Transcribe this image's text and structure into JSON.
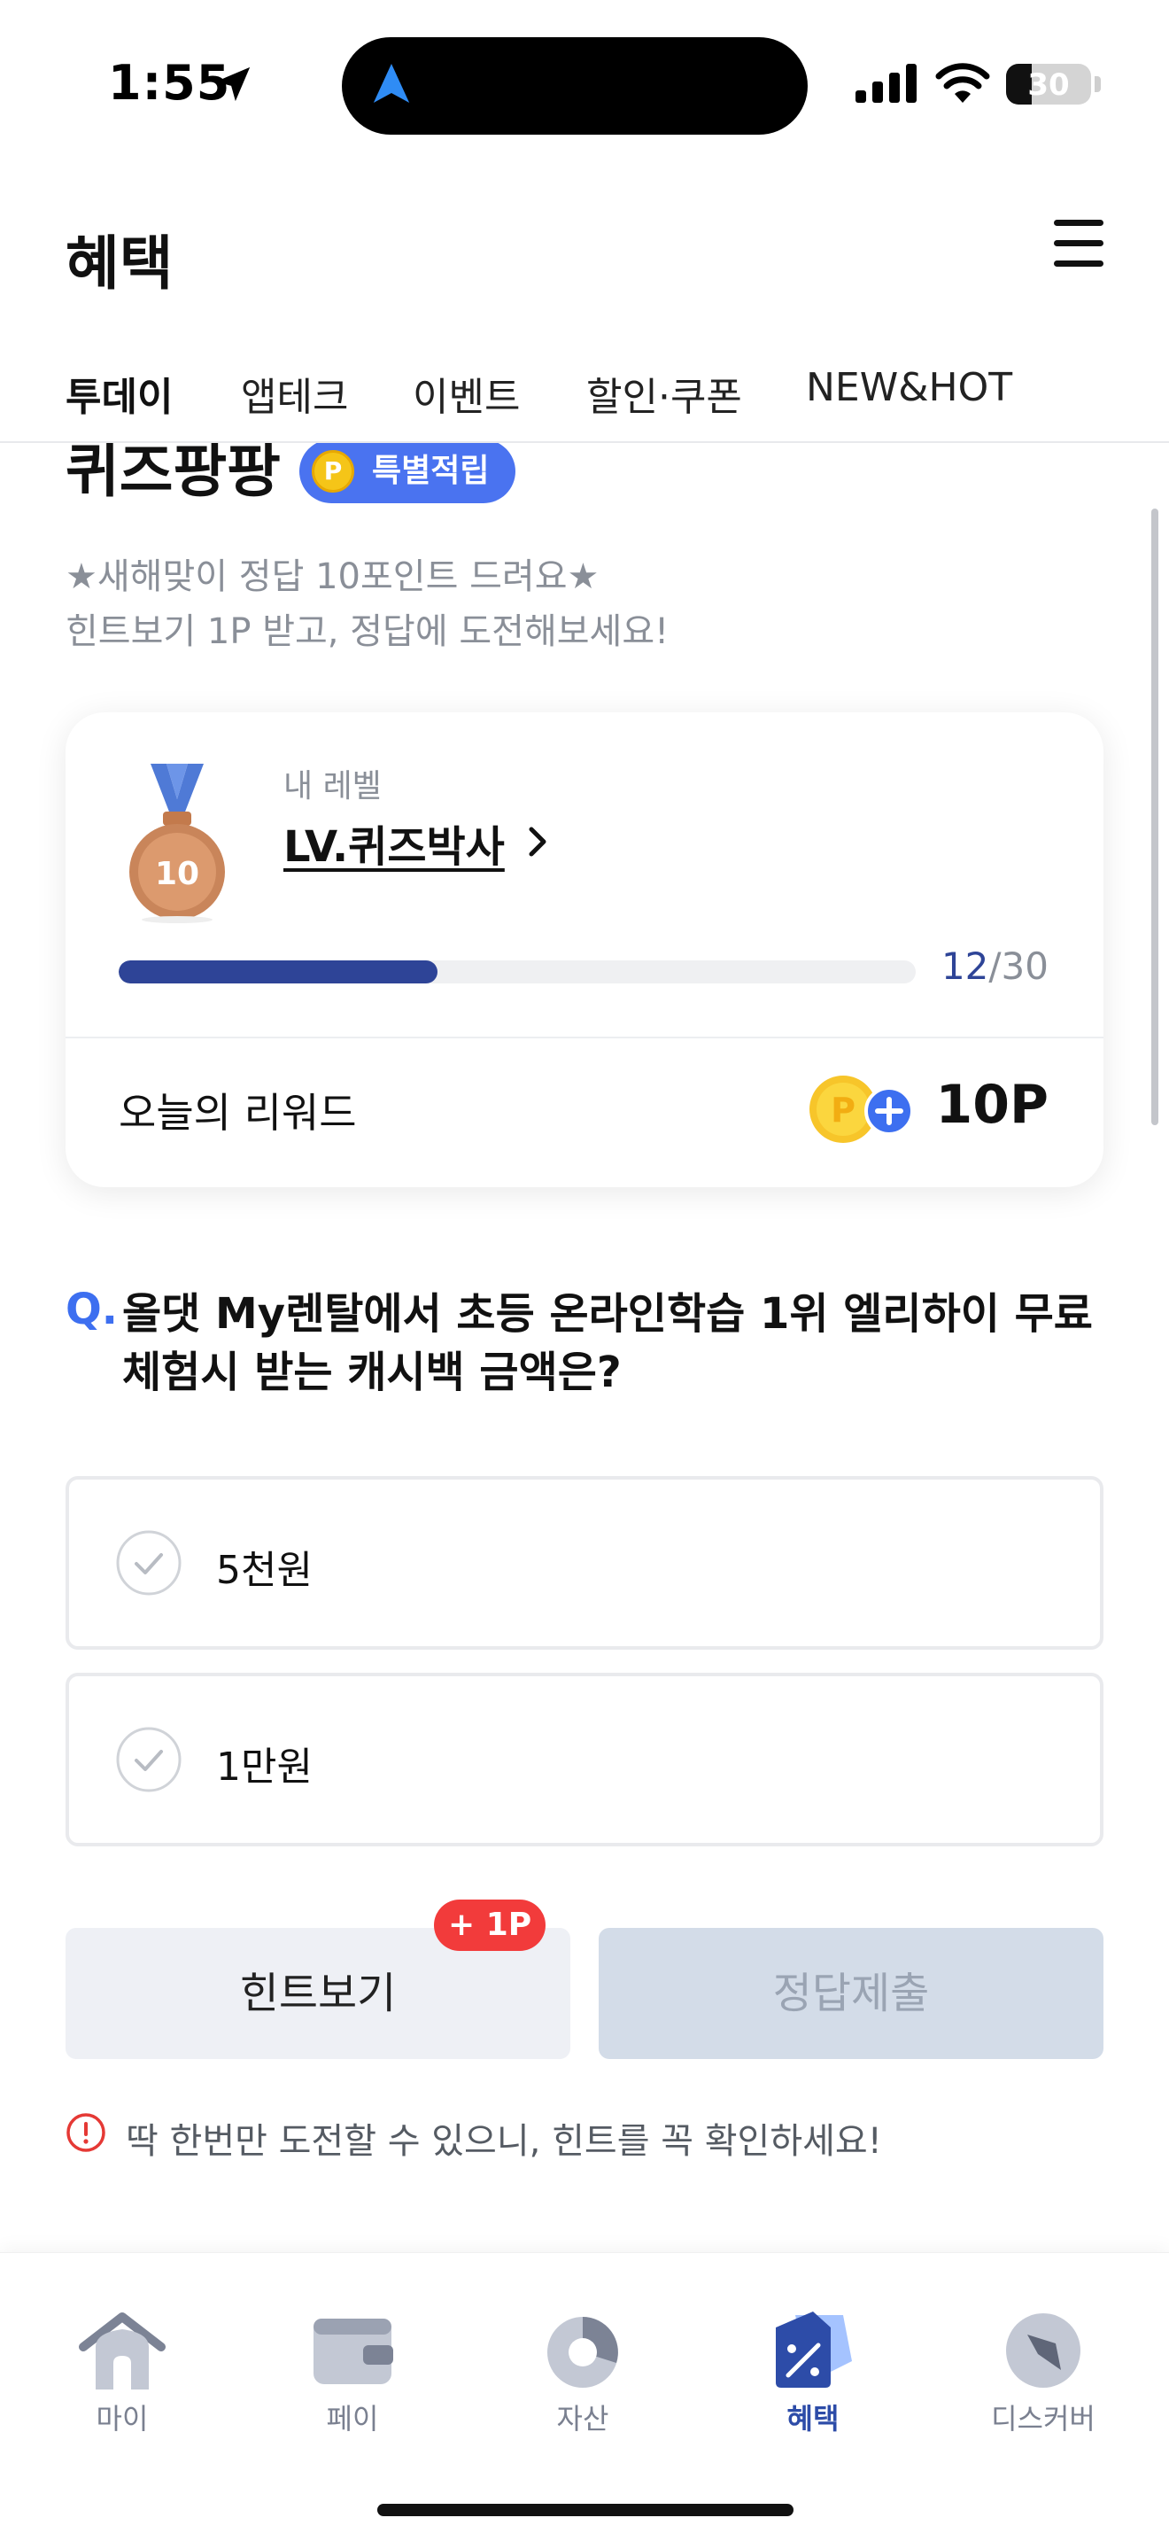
{
  "status_bar": {
    "time": "1:55",
    "battery": "30"
  },
  "header": {
    "title": "혜택"
  },
  "tabs": [
    {
      "label": "투데이",
      "active": true
    },
    {
      "label": "앱테크",
      "active": false
    },
    {
      "label": "이벤트",
      "active": false
    },
    {
      "label": "할인·쿠폰",
      "active": false
    },
    {
      "label": "NEW&HOT",
      "active": false
    }
  ],
  "quiz": {
    "title": "퀴즈팡팡",
    "badge": "특별적립",
    "coin_letter": "P",
    "description_line1": "★새해맞이 정답 10포인트 드려요★",
    "description_line2": "힌트보기 1P 받고, 정답에 도전해보세요!"
  },
  "level_card": {
    "medal_number": "10",
    "label": "내 레벨",
    "name": "LV.퀴즈박사",
    "progress_current": "12",
    "progress_separator": "/",
    "progress_total": "30",
    "progress_fraction": 0.4,
    "reward_label": "오늘의 리워드",
    "reward_value": "10P"
  },
  "question": {
    "marker": "Q.",
    "text": "올댓 My렌탈에서 초등 온라인학습 1위 엘리하이 무료 체험시 받는 캐시백 금액은?",
    "options": [
      {
        "label": "5천원"
      },
      {
        "label": "1만원"
      }
    ]
  },
  "actions": {
    "hint_label": "힌트보기",
    "hint_badge": "+ 1P",
    "submit_label": "정답제출"
  },
  "warning": {
    "text": "딱 한번만 도전할 수 있으니, 힌트를 꼭 확인하세요!"
  },
  "bottom_nav": [
    {
      "label": "마이",
      "icon": "home-icon",
      "active": false
    },
    {
      "label": "페이",
      "icon": "wallet-icon",
      "active": false
    },
    {
      "label": "자산",
      "icon": "pie-chart-icon",
      "active": false
    },
    {
      "label": "혜택",
      "icon": "benefit-tag-icon",
      "active": true
    },
    {
      "label": "디스커버",
      "icon": "compass-icon",
      "active": false
    }
  ],
  "colors": {
    "accent_blue": "#3d6ff0",
    "progress_navy": "#2e4497",
    "badge_red": "#f23b3b",
    "nav_active": "#2d4ca8"
  }
}
